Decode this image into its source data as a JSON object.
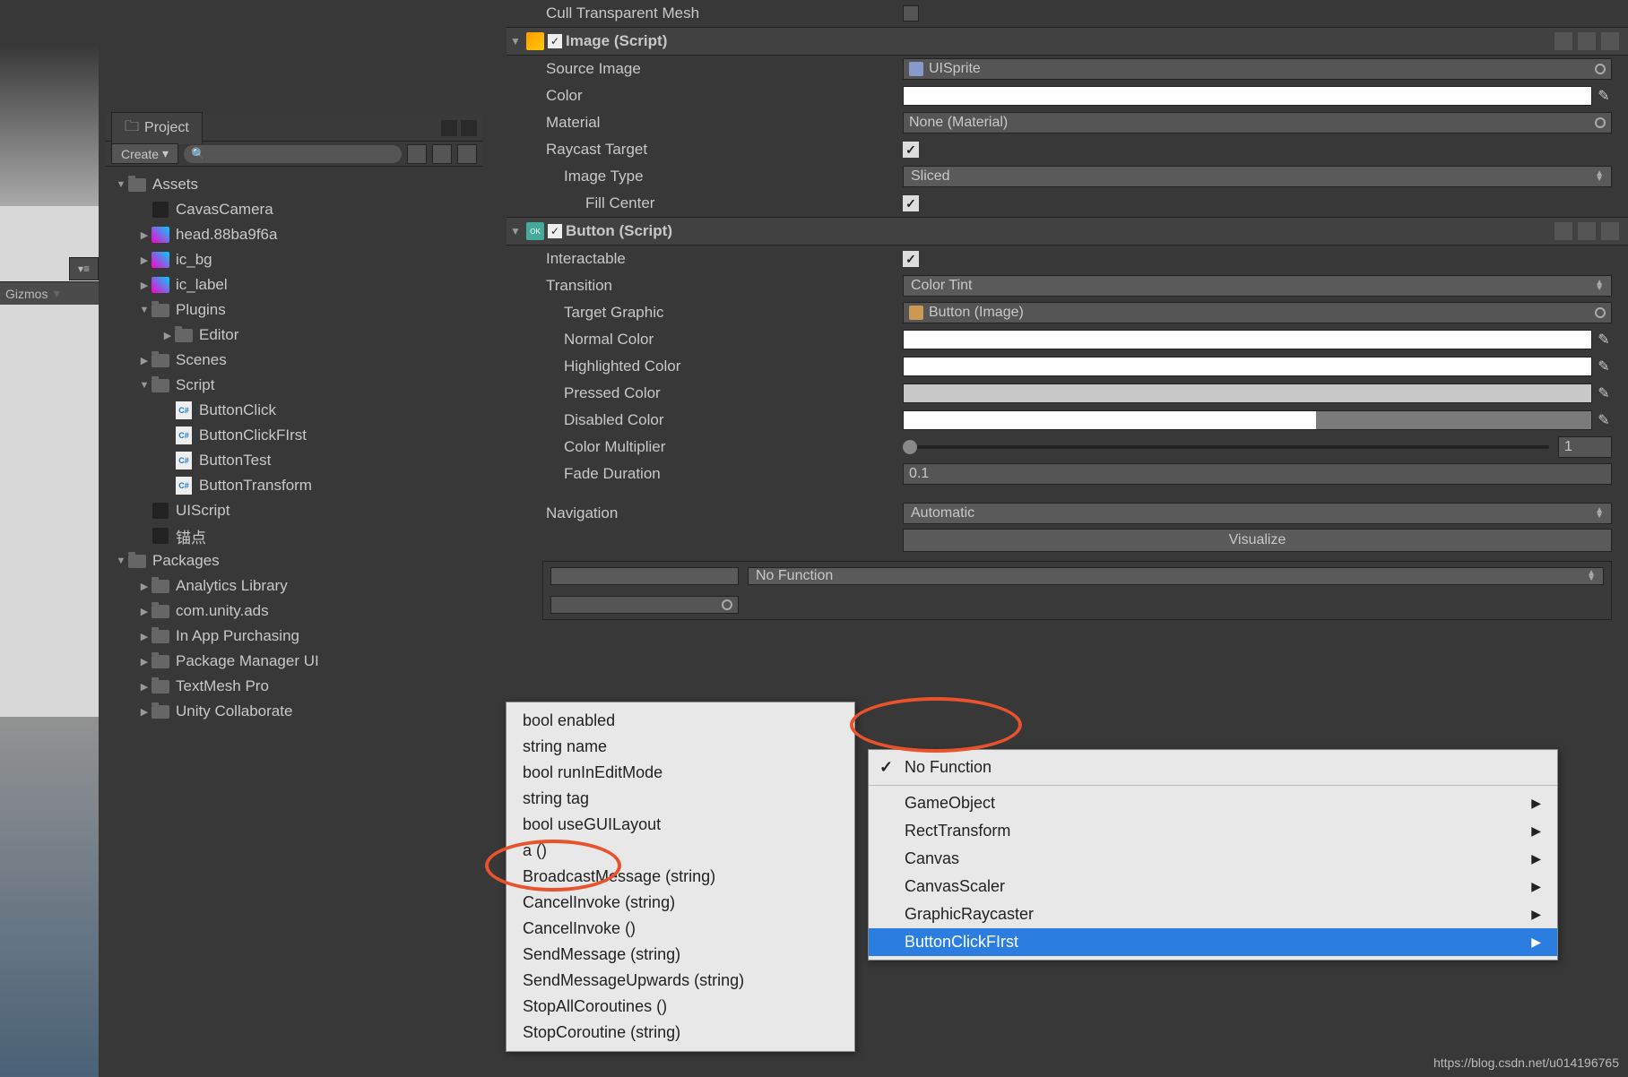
{
  "left": {
    "handle": "▾≡",
    "gizmos": "Gizmos"
  },
  "project": {
    "tab": "Project",
    "create": "Create",
    "search_placeholder": "",
    "tree": {
      "assets": "Assets",
      "items": [
        {
          "label": "CavasCamera",
          "type": "unity",
          "indent": 1,
          "arrow": ""
        },
        {
          "label": "head.88ba9f6a",
          "type": "img",
          "indent": 1,
          "arrow": "▶"
        },
        {
          "label": "ic_bg",
          "type": "img",
          "indent": 1,
          "arrow": "▶"
        },
        {
          "label": "ic_label",
          "type": "img",
          "indent": 1,
          "arrow": "▶"
        },
        {
          "label": "Plugins",
          "type": "folder",
          "indent": 1,
          "arrow": "▼"
        },
        {
          "label": "Editor",
          "type": "folder",
          "indent": 2,
          "arrow": "▶"
        },
        {
          "label": "Scenes",
          "type": "folder",
          "indent": 1,
          "arrow": "▶"
        },
        {
          "label": "Script",
          "type": "folder",
          "indent": 1,
          "arrow": "▼"
        },
        {
          "label": "ButtonClick",
          "type": "cs",
          "indent": 2,
          "arrow": ""
        },
        {
          "label": "ButtonClickFIrst",
          "type": "cs",
          "indent": 2,
          "arrow": ""
        },
        {
          "label": "ButtonTest",
          "type": "cs",
          "indent": 2,
          "arrow": ""
        },
        {
          "label": "ButtonTransform",
          "type": "cs",
          "indent": 2,
          "arrow": ""
        },
        {
          "label": "UIScript",
          "type": "unity",
          "indent": 1,
          "arrow": ""
        },
        {
          "label": "锚点",
          "type": "unity",
          "indent": 1,
          "arrow": ""
        }
      ],
      "packages": "Packages",
      "pkg_items": [
        "Analytics Library",
        "com.unity.ads",
        "In App Purchasing",
        "Package Manager UI",
        "TextMesh Pro",
        "Unity Collaborate"
      ]
    }
  },
  "inspector": {
    "cull_transparent": "Cull Transparent Mesh",
    "image_header": "Image (Script)",
    "image": {
      "source_label": "Source Image",
      "source_value": "UISprite",
      "color_label": "Color",
      "material_label": "Material",
      "material_value": "None (Material)",
      "raycast_label": "Raycast Target",
      "type_label": "Image Type",
      "type_value": "Sliced",
      "fill_label": "Fill Center"
    },
    "button_header": "Button (Script)",
    "button_ok": "OK",
    "button": {
      "interactable_label": "Interactable",
      "transition_label": "Transition",
      "transition_value": "Color Tint",
      "target_label": "Target Graphic",
      "target_value": "Button (Image)",
      "normal_label": "Normal Color",
      "highlighted_label": "Highlighted Color",
      "pressed_label": "Pressed Color",
      "disabled_label": "Disabled Color",
      "multiplier_label": "Color Multiplier",
      "multiplier_value": "1",
      "fade_label": "Fade Duration",
      "fade_value": "0.1",
      "nav_label": "Navigation",
      "nav_value": "Automatic",
      "visualize": "Visualize"
    },
    "event": {
      "no_function": "No Function"
    }
  },
  "menu1": [
    "bool enabled",
    "string name",
    "bool runInEditMode",
    "string tag",
    "bool useGUILayout",
    "a ()",
    "BroadcastMessage (string)",
    "CancelInvoke (string)",
    "CancelInvoke ()",
    "SendMessage (string)",
    "SendMessageUpwards (string)",
    "StopAllCoroutines ()",
    "StopCoroutine (string)"
  ],
  "menu2": {
    "no_function": "No Function",
    "items": [
      {
        "label": "GameObject",
        "sub": true
      },
      {
        "label": "RectTransform",
        "sub": true
      },
      {
        "label": "Canvas",
        "sub": true
      },
      {
        "label": "CanvasScaler",
        "sub": true
      },
      {
        "label": "GraphicRaycaster",
        "sub": true
      },
      {
        "label": "ButtonClickFIrst",
        "sub": true,
        "sel": true
      }
    ]
  },
  "watermark": "https://blog.csdn.net/u014196765"
}
